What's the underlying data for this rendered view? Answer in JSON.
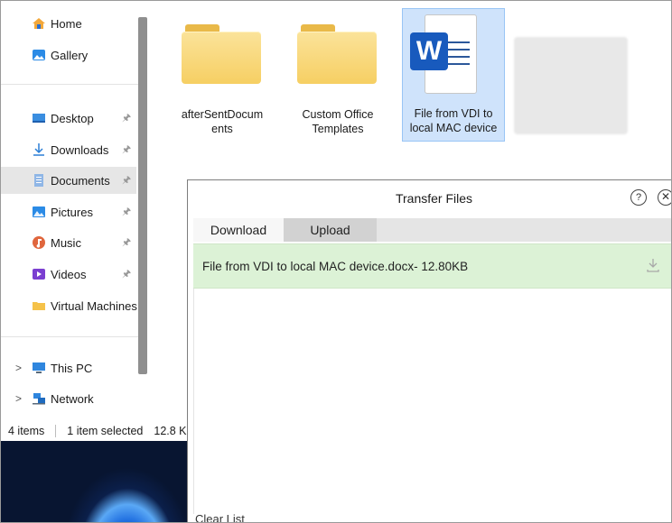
{
  "nav": {
    "home": "Home",
    "gallery": "Gallery",
    "desktop": "Desktop",
    "downloads": "Downloads",
    "documents": "Documents",
    "pictures": "Pictures",
    "music": "Music",
    "videos": "Videos",
    "virtual_machines": "Virtual Machines",
    "this_pc": "This PC",
    "network": "Network",
    "pin_glyph": "📌",
    "chevron": ">"
  },
  "status": {
    "items": "4 items",
    "selected": "1 item selected",
    "size": "12.8 K"
  },
  "files": [
    {
      "name_line1": "afterSentDocum",
      "name_line2": "ents"
    },
    {
      "name_line1": "Custom Office",
      "name_line2": "Templates"
    },
    {
      "name_line1": "File from VDI to",
      "name_line2": "local MAC device"
    }
  ],
  "dialog": {
    "title": "Transfer Files",
    "help": "?",
    "close": "✕",
    "tab_download": "Download",
    "tab_upload": "Upload",
    "row_text": "File from VDI to local MAC device.docx- 12.80KB",
    "clear_list": "Clear List"
  },
  "colors": {
    "row_bg": "#dcf2d6",
    "selection": "#cfe3fb",
    "word_blue": "#185abd"
  }
}
